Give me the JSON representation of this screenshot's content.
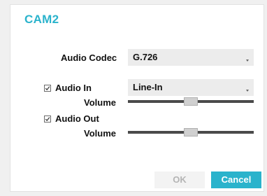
{
  "dialog": {
    "title": "CAM2"
  },
  "audio_codec": {
    "label": "Audio Codec",
    "value": "G.726"
  },
  "audio_in": {
    "label": "Audio In",
    "checked": true,
    "source_value": "Line-In",
    "volume_label": "Volume",
    "volume_level_percent": 50
  },
  "audio_out": {
    "label": "Audio Out",
    "checked": true,
    "volume_label": "Volume",
    "volume_level_percent": 50
  },
  "buttons": {
    "ok_label": "OK",
    "cancel_label": "Cancel"
  },
  "colors": {
    "accent": "#2ab3cc",
    "disabled_text": "#b4b4b4"
  },
  "icons": {
    "checkbox_check": "check-icon",
    "dropdown_arrow": "chevron-down-icon"
  }
}
